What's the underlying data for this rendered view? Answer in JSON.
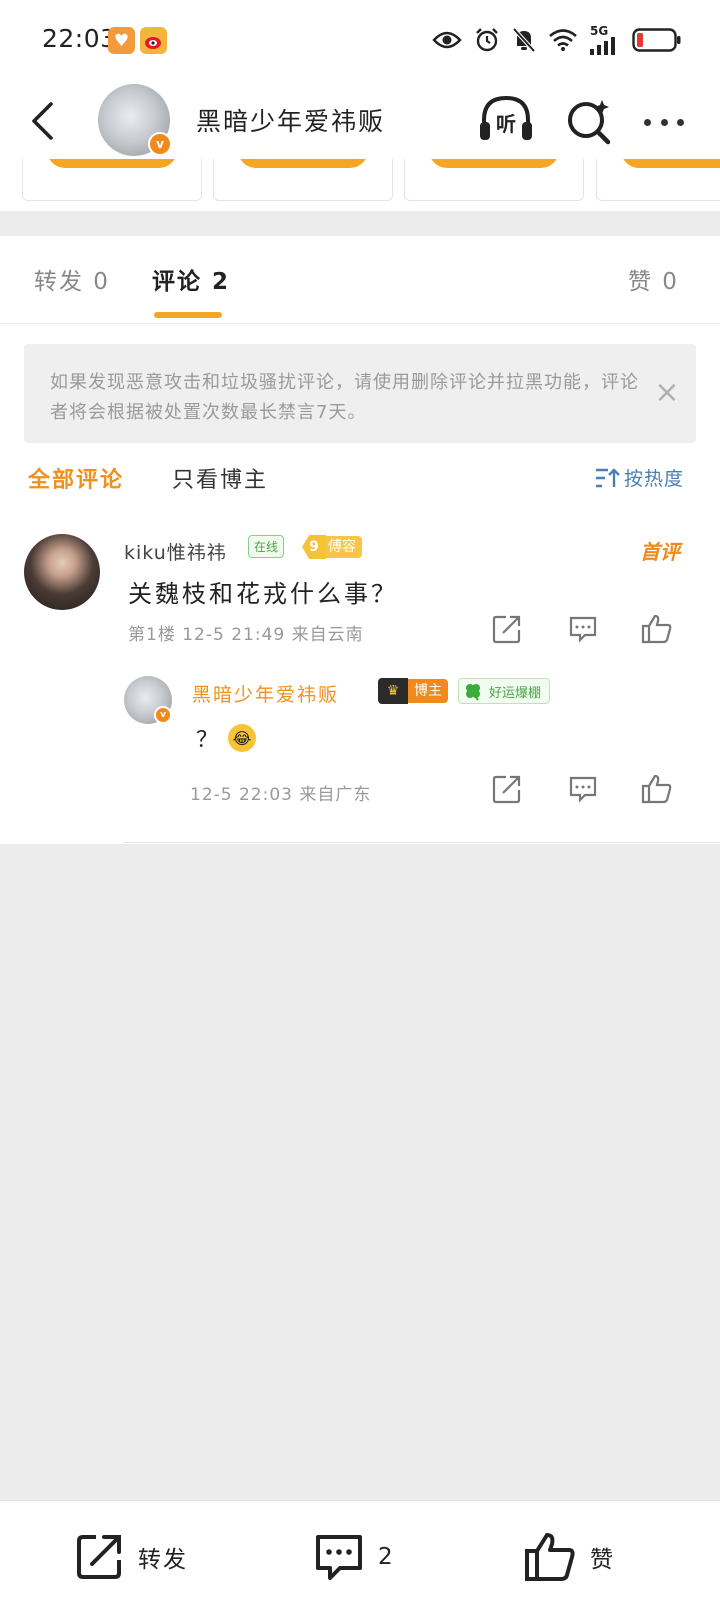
{
  "status_bar": {
    "time": "22:03",
    "network": "5G",
    "icons": [
      "heart-app-icon",
      "weibo-app-icon",
      "eye-icon",
      "alarm-icon",
      "bell-off-icon",
      "wifi-icon",
      "signal-icon",
      "battery-icon"
    ]
  },
  "header": {
    "account_name": "黑暗少年爱祎贩",
    "verified_badge": "v",
    "listen_label": "听"
  },
  "tabs": {
    "repost": "转发 0",
    "comment": "评论 2",
    "like": "赞 0"
  },
  "notice": {
    "text": "如果发现恶意攻击和垃圾骚扰评论，请使用删除评论并拉黑功能，评论者将会根据被处置次数最长禁言7天。",
    "close": "×"
  },
  "filters": {
    "all": "全部评论",
    "blogger_only": "只看博主",
    "sort": "按热度"
  },
  "comments": [
    {
      "user": "kiku惟祎祎",
      "online_badge": "在线",
      "fan_level": "9",
      "fan_badge": "傅容",
      "first_badge": "首评",
      "text": "关魏枝和花戎什么事？",
      "meta": "第1楼  12-5 21:49  来自云南",
      "reply": {
        "user": "黑暗少年爱祎贩",
        "verified_badge": "v",
        "blogger_badge": "博主",
        "luck_badge": "好运爆棚",
        "text": "？",
        "emoji": "😂",
        "meta": "12-5 22:03  来自广东"
      }
    }
  ],
  "bottom_bar": {
    "repost": "转发",
    "comment_count": "2",
    "like": "赞"
  },
  "colors": {
    "accent_orange": "#f0901e",
    "tab_underline": "#f5a623",
    "link_blue": "#4a7eb4",
    "badge_green": "#4aa647"
  }
}
